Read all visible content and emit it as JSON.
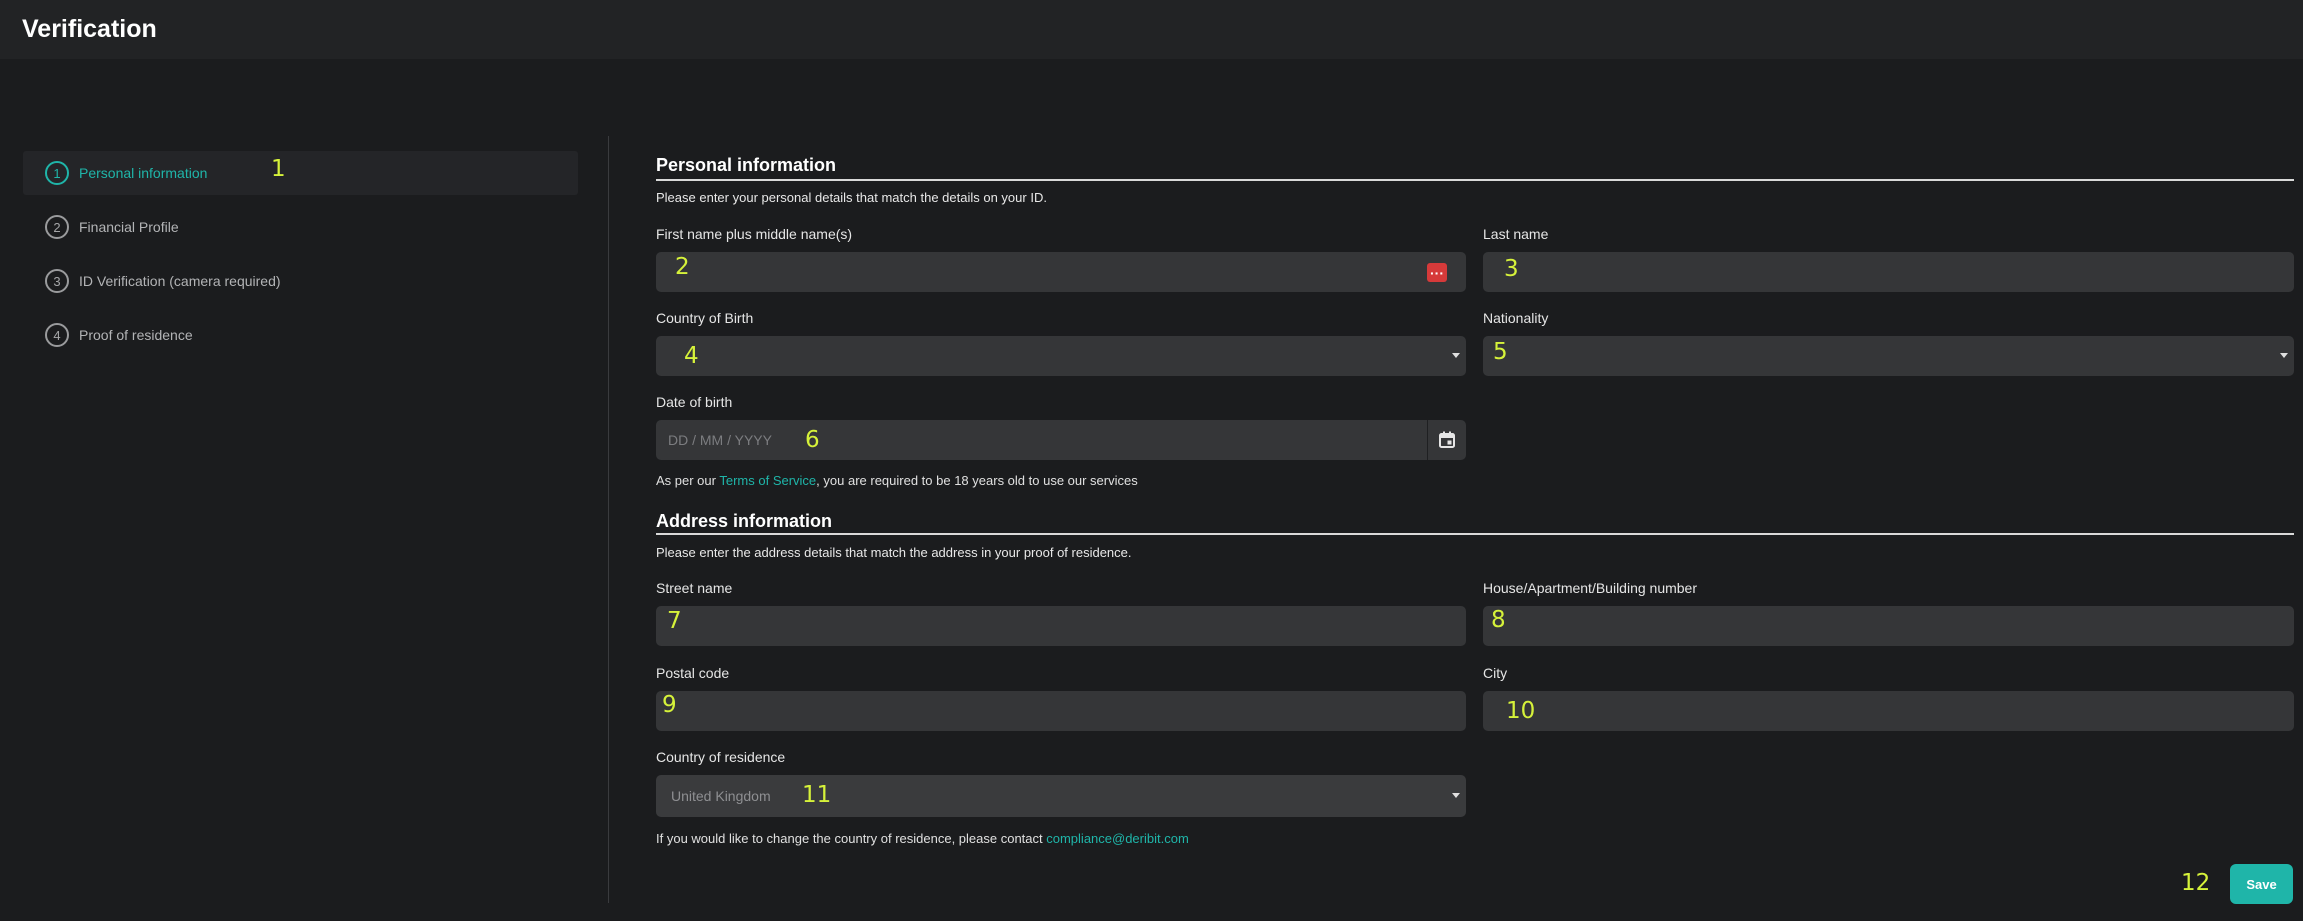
{
  "header": {
    "title": "Verification"
  },
  "sidebar": {
    "steps": [
      {
        "number": "1",
        "label": "Personal information",
        "active": true
      },
      {
        "number": "2",
        "label": "Financial Profile",
        "active": false
      },
      {
        "number": "3",
        "label": "ID Verification (camera required)",
        "active": false
      },
      {
        "number": "4",
        "label": "Proof of residence",
        "active": false
      }
    ]
  },
  "personal": {
    "title": "Personal information",
    "description": "Please enter your personal details that match the details on your ID.",
    "first_name_label": "First name plus middle name(s)",
    "last_name_label": "Last name",
    "country_birth_label": "Country of Birth",
    "nationality_label": "Nationality",
    "dob_label": "Date of birth",
    "dob_placeholder": "DD / MM / YYYY",
    "age_note_prefix": "As per our ",
    "age_note_link": "Terms of Service",
    "age_note_suffix": ", you are required to be 18 years old to use our services"
  },
  "address": {
    "title": "Address information",
    "description": "Please enter the address details that match the address in your proof of residence.",
    "street_label": "Street name",
    "house_label": "House/Apartment/Building number",
    "postal_label": "Postal code",
    "city_label": "City",
    "country_label": "Country of residence",
    "country_value": "United Kingdom",
    "contact_prefix": "If you would like to change the country of residence, please contact ",
    "contact_email": "compliance@deribit.com"
  },
  "actions": {
    "save_label": "Save"
  },
  "overlay_numbers": [
    "1",
    "2",
    "3",
    "4",
    "5",
    "6",
    "7",
    "8",
    "9",
    "10",
    "11",
    "12"
  ],
  "icons": {
    "password_manager": "password-dots-icon",
    "calendar": "calendar-icon",
    "dropdown": "chevron-down-icon"
  },
  "colors": {
    "accent": "#1fb5a9",
    "background": "#1b1c1e",
    "field": "#353638",
    "marker": "#d6f23a"
  }
}
